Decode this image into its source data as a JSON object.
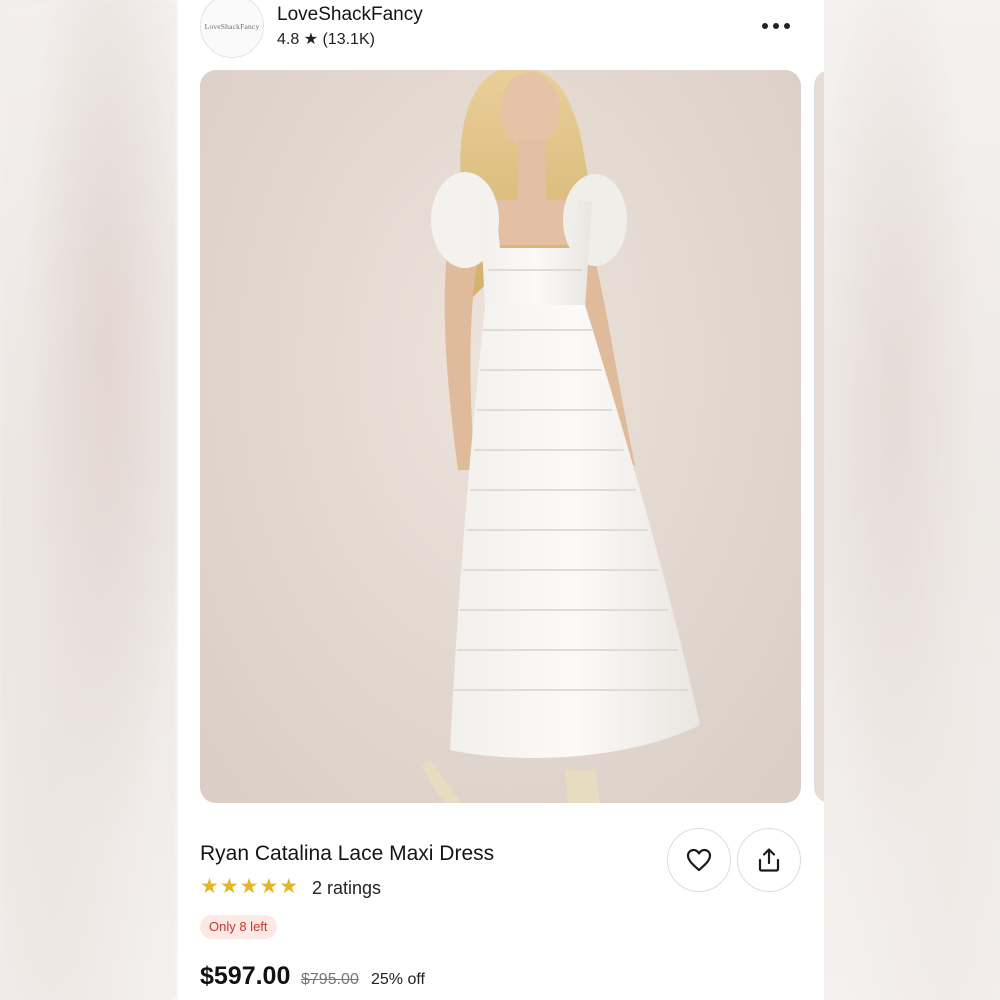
{
  "shop": {
    "logo_text": "LoveShackFancy",
    "name": "LoveShackFancy",
    "rating": "4.8 ★ (13.1K)"
  },
  "product": {
    "image_icon": "product-photo-white-lace-maxi-dress",
    "title": "Ryan Catalina Lace Maxi Dress",
    "stars": [
      "★",
      "★",
      "★",
      "★",
      "★"
    ],
    "rating_count": "2 ratings",
    "stock": "Only 8 left",
    "price": "$597.00",
    "original_price": "$795.00",
    "discount": "25% off"
  },
  "actions": {
    "more_icon": "more-horizontal-icon",
    "favorite_icon": "heart-icon",
    "share_icon": "share-icon"
  },
  "colors": {
    "star": "#e2b625",
    "badge_bg": "#fde8e6",
    "badge_text": "#c0392b"
  }
}
